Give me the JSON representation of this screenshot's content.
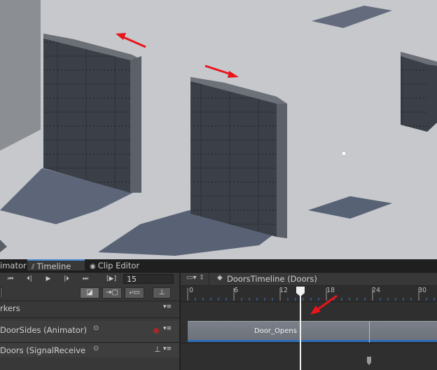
{
  "tabs": [
    {
      "label": "imator",
      "icon": "animator-icon"
    },
    {
      "label": "Timeline",
      "icon": "timeline-icon"
    },
    {
      "label": "Clip Editor",
      "icon": "eye-icon"
    }
  ],
  "toolbar": {
    "frame_value": "15"
  },
  "timeline": {
    "asset_label": "DoorsTimeline (Doors)",
    "ticks": [
      "0",
      "6",
      "12",
      "18",
      "24",
      "30"
    ]
  },
  "tracks": {
    "markers_label": "rkers",
    "animator_track_label": "DoorSides (Animator)",
    "signal_track_label": "Doors (SignalReceive"
  },
  "clip": {
    "label": "Door_Opens"
  },
  "colors": {
    "accent": "#4b8bd0",
    "arrow": "#e8151b",
    "record": "#a32a2a"
  }
}
